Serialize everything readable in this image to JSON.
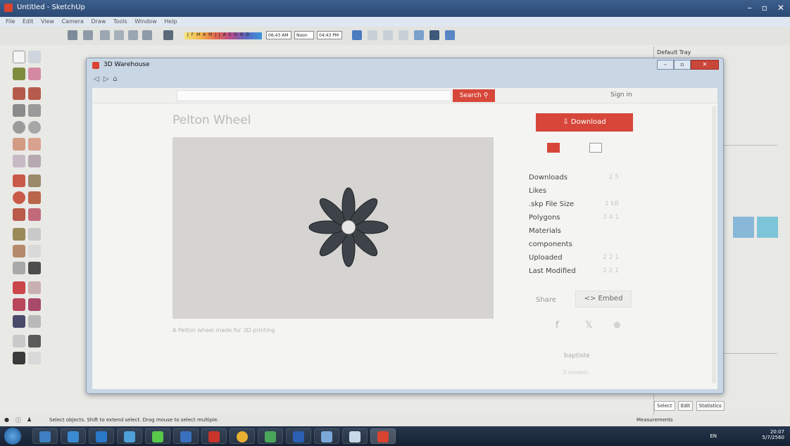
{
  "window": {
    "title": "Untitled - SketchUp",
    "controls": [
      "–",
      "▫",
      "✕"
    ]
  },
  "menu": [
    "File",
    "Edit",
    "View",
    "Camera",
    "Draw",
    "Tools",
    "Window",
    "Help"
  ],
  "toolbar": {
    "shadow_months": "J F M A M J J A S O N D",
    "time_start": "06:43 AM",
    "noon": "Noon",
    "time_end": "04:43 PM"
  },
  "right_panel": {
    "title": "Default Tray",
    "tabs": [
      "Select",
      "Edit",
      "Statistics"
    ]
  },
  "modal": {
    "title": "3D Warehouse",
    "nav": [
      "◁",
      "▷",
      "⌂"
    ],
    "search_placeholder": "",
    "search_button": "Search",
    "sign_in": "Sign in",
    "model_title": "Pelton Wheel",
    "description": "A Pelton wheel made for 3D printing",
    "download_button": "Download",
    "stats": [
      {
        "label": "Downloads",
        "value": "2 5"
      },
      {
        "label": "Likes",
        "value": ""
      },
      {
        "label": ".skp File Size",
        "value": "1 kB"
      },
      {
        "label": "Polygons",
        "value": "3 4 1"
      },
      {
        "label": "Materials",
        "value": ""
      },
      {
        "label": "components",
        "value": ""
      },
      {
        "label": "Uploaded",
        "value": "2 2 1"
      },
      {
        "label": "Last Modified",
        "value": "2 2 1"
      }
    ],
    "share_label": "Share",
    "embed_button": "<> Embed",
    "social": [
      "f",
      "𝕏",
      "⊕"
    ],
    "author": "baptiste",
    "author_models": "3 models"
  },
  "status": {
    "hint": "Select objects. Shift to extend select. Drag mouse to select multiple.",
    "measurements": "Measurements"
  },
  "taskbar": {
    "language": "EN",
    "time": "20:07",
    "date": "5/7/2560"
  },
  "colors": {
    "accent": "#d6473a",
    "taskbar": "#1a283b"
  }
}
